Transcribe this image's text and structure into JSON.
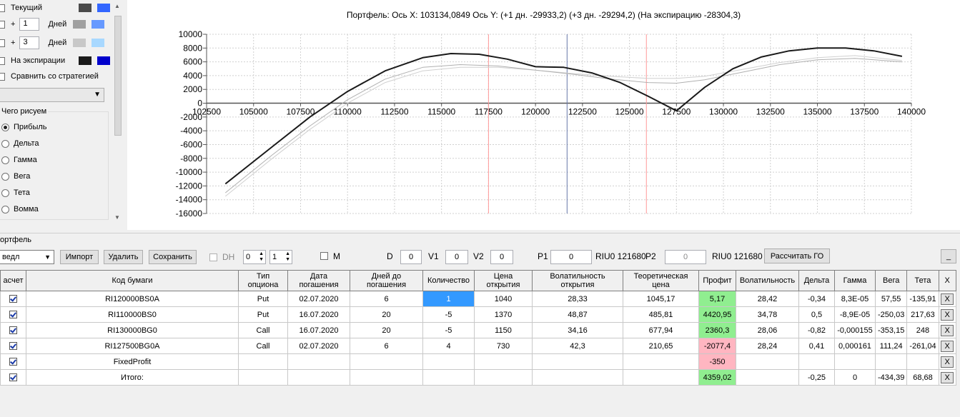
{
  "left": {
    "current_label": "Текущий",
    "plus1_prefix": "+",
    "plus1_value": "1",
    "plus1_unit": "Дней",
    "plus3_prefix": "+",
    "plus3_value": "3",
    "plus3_unit": "Дней",
    "expiry_label": "На экспирации",
    "compare_label": "Сравнить со стратегией",
    "draw_group_label": "Чего рисуем",
    "radios": [
      "Прибыль",
      "Дельта",
      "Гамма",
      "Вега",
      "Тета",
      "Вомма"
    ],
    "colors": {
      "current_a": "#4a4a4a",
      "current_b": "#3366ff",
      "plus1_a": "#a0a0a0",
      "plus1_b": "#6699ff",
      "plus3_a": "#c8c8c8",
      "plus3_b": "#a8d8ff",
      "expiry_a": "#1a1a1a",
      "expiry_b": "#0000cc"
    }
  },
  "chart_title": "Портфель: Ось X:  103134,0849 Ось Y:   (+1 дн. -29933,2)  (+3 дн. -29294,2)  (На экспирацию -28304,3)",
  "chart_data": {
    "type": "line",
    "xlim": [
      102500,
      140000
    ],
    "ylim": [
      -16000,
      10000
    ],
    "x_ticks": [
      "102500",
      "105000",
      "107500",
      "110000",
      "112500",
      "115000",
      "117500",
      "120000",
      "122500",
      "125000",
      "127500",
      "130000",
      "132500",
      "135000",
      "137500",
      "140000"
    ],
    "y_ticks": [
      "10000",
      "8000",
      "6000",
      "4000",
      "2000",
      "0",
      "-2000",
      "-4000",
      "-6000",
      "-8000",
      "-10000",
      "-12000",
      "-14000",
      "-16000"
    ],
    "vertical_markers": [
      {
        "x": 117500,
        "color": "#ff9999"
      },
      {
        "x": 121680,
        "color": "#6677aa"
      },
      {
        "x": 125900,
        "color": "#ff9999"
      }
    ],
    "series": [
      {
        "color": "#1a1a1a",
        "width": 2,
        "x": [
          103500,
          106000,
          108000,
          110000,
          112000,
          114000,
          115500,
          117000,
          118500,
          120000,
          121500,
          123000,
          124500,
          126000,
          127500,
          129000,
          130500,
          132000,
          133500,
          135000,
          136500,
          138000,
          139500
        ],
        "y": [
          -11700,
          -6300,
          -2000,
          1700,
          4700,
          6600,
          7200,
          7100,
          6400,
          5300,
          5200,
          4400,
          3000,
          1000,
          -1100,
          2300,
          5000,
          6700,
          7600,
          8000,
          8000,
          7600,
          6800
        ]
      },
      {
        "color": "#b0b0b0",
        "width": 1,
        "x": [
          103500,
          106000,
          108000,
          110000,
          112000,
          114000,
          116000,
          118000,
          120000,
          122000,
          124000,
          126000,
          127500,
          129000,
          131000,
          133000,
          135000,
          137000,
          139500
        ],
        "y": [
          -13000,
          -7500,
          -3300,
          500,
          3500,
          5200,
          5600,
          5400,
          4800,
          4200,
          3500,
          3000,
          2900,
          3400,
          4500,
          5600,
          6300,
          6500,
          6000
        ]
      },
      {
        "color": "#d0d0d0",
        "width": 1,
        "x": [
          103500,
          106000,
          108000,
          110000,
          112000,
          114000,
          116000,
          118000,
          120000,
          122000,
          124000,
          126000,
          127500,
          129000,
          131000,
          133000,
          135000,
          137000,
          139500
        ],
        "y": [
          -13500,
          -8000,
          -3800,
          0,
          3000,
          4700,
          5200,
          5200,
          4800,
          4300,
          3900,
          3600,
          3600,
          3900,
          4900,
          5900,
          6600,
          6900,
          6200
        ]
      }
    ]
  },
  "toolbar": {
    "section_label": "ортфель",
    "strategy_value": "ведл",
    "import_label": "Импорт",
    "delete_label": "Удалить",
    "save_label": "Сохранить",
    "dh_label": "DH",
    "dh_spin1": "0",
    "dh_spin2": "1",
    "m_label": "M",
    "d_label": "D",
    "d_value": "0",
    "v1_label": "V1",
    "v1_value": "0",
    "v2_label": "V2",
    "v2_value": "0",
    "p1_label": "P1",
    "p1_value": "0",
    "p1_ticker": "RIU0 121680",
    "p2_label": "P2",
    "p2_value": "0",
    "p2_ticker": "RIU0 121680",
    "calc_label": "Рассчитать ГО",
    "minimize_label": "_"
  },
  "grid": {
    "headers": [
      "асчет",
      "Код бумаги",
      "Тип опциона",
      "Дата погашения",
      "Дней до погашения",
      "Количество",
      "Цена открытия",
      "Волатильность открытия",
      "Теоретическая цена",
      "Профит",
      "Волатильность",
      "Дельта",
      "Гамма",
      "Вега",
      "Тета",
      "X"
    ],
    "rows": [
      {
        "code": "RI120000BS0A",
        "type": "Put",
        "date": "02.07.2020",
        "days": "6",
        "qty": "1",
        "price": "1040",
        "vol_open": "28,33",
        "theor": "1045,17",
        "profit": "5,17",
        "vol": "28,42",
        "delta": "-0,34",
        "gamma": "8,3E-05",
        "vega": "57,55",
        "theta": "-135,91",
        "x": "X"
      },
      {
        "code": "RI110000BS0",
        "type": "Put",
        "date": "16.07.2020",
        "days": "20",
        "qty": "-5",
        "price": "1370",
        "vol_open": "48,87",
        "theor": "485,81",
        "profit": "4420,95",
        "vol": "34,78",
        "delta": "0,5",
        "gamma": "-8,9E-05",
        "vega": "-250,03",
        "theta": "217,63",
        "x": "X"
      },
      {
        "code": "RI130000BG0",
        "type": "Call",
        "date": "16.07.2020",
        "days": "20",
        "qty": "-5",
        "price": "1150",
        "vol_open": "34,16",
        "theor": "677,94",
        "profit": "2360,3",
        "vol": "28,06",
        "delta": "-0,82",
        "gamma": "-0,000155",
        "vega": "-353,15",
        "theta": "248",
        "x": "X"
      },
      {
        "code": "RI127500BG0A",
        "type": "Call",
        "date": "02.07.2020",
        "days": "6",
        "qty": "4",
        "price": "730",
        "vol_open": "42,3",
        "theor": "210,65",
        "profit": "-2077,4",
        "vol": "28,24",
        "delta": "0,41",
        "gamma": "0,000161",
        "vega": "111,24",
        "theta": "-261,04",
        "x": "X"
      },
      {
        "code": "FixedProfit",
        "type": "",
        "date": "",
        "days": "",
        "qty": "",
        "price": "",
        "vol_open": "",
        "theor": "",
        "profit": "-350",
        "vol": "",
        "delta": "",
        "gamma": "",
        "vega": "",
        "theta": "",
        "x": "X"
      },
      {
        "code": "Итого:",
        "type": "",
        "date": "",
        "days": "",
        "qty": "",
        "price": "",
        "vol_open": "",
        "theor": "",
        "profit": "4359,02",
        "vol": "",
        "delta": "-0,25",
        "gamma": "0",
        "vega": "-434,39",
        "theta": "68,68",
        "x": "X"
      }
    ]
  }
}
